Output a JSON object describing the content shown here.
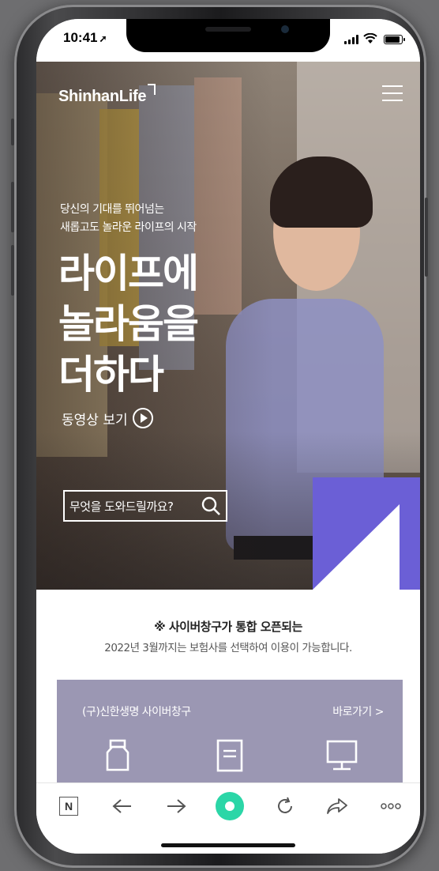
{
  "status_bar": {
    "time": "10:41",
    "time_arrow": "➚"
  },
  "header": {
    "logo_text": "ShinhanLife",
    "menu_icon": "hamburger-menu-icon"
  },
  "hero": {
    "kicker_line1": "당신의 기대를 뛰어넘는",
    "kicker_line2": "새롭고도 놀라운 라이프의 시작",
    "headline_line1": "라이프에",
    "headline_line2": "놀라움을",
    "headline_line3": "더하다",
    "video_label": "동영상 보기",
    "search_placeholder": "무엇을 도와드릴까요?",
    "accent_color": "#6b5fd6"
  },
  "notice": {
    "title": "※ 사이버창구가 통합 오픈되는",
    "body": "2022년 3월까지는 보험사를 선택하여 이용이 가능합니다."
  },
  "cyber_card": {
    "title": "(구)신한생명 사이버창구",
    "link_label": "바로가기 >",
    "icons": [
      "bottle-icon",
      "document-icon",
      "monitor-icon"
    ],
    "card_color": "#9b97b3"
  },
  "browser_bar": {
    "naver_label": "N",
    "icons": [
      "naver-icon",
      "back-arrow-icon",
      "forward-arrow-icon",
      "home-circle-icon",
      "refresh-icon",
      "share-icon",
      "more-icon"
    ],
    "home_color": "#2bd6a7"
  }
}
